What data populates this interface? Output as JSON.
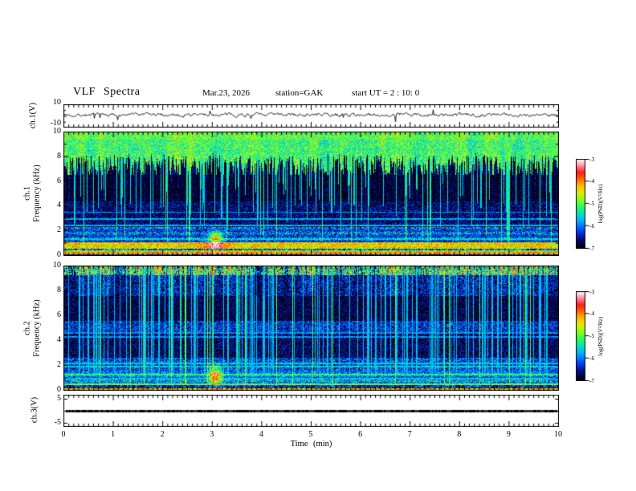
{
  "header": {
    "title": "VLF  Spectra",
    "date": "Mar.23, 2026",
    "station": "station=GAK",
    "start_ut": "start UT =  2 : 10: 0"
  },
  "xaxis": {
    "label": "Time  (min)",
    "ticks": [
      "0",
      "1",
      "2",
      "3",
      "4",
      "5",
      "6",
      "7",
      "8",
      "9",
      "10"
    ],
    "range": [
      0,
      10
    ]
  },
  "panels": {
    "ch1_wave": {
      "label": "ch.1(V)",
      "ytick_top": "10",
      "ytick_bottom": "-10",
      "ylim": [
        -10,
        10
      ]
    },
    "ch1_spec": {
      "label_ch": "ch.1",
      "label_axis": "Frequency  (kHz)",
      "yticks": [
        "0",
        "2",
        "4",
        "6",
        "8",
        "10"
      ],
      "ylim": [
        0,
        10
      ]
    },
    "ch2_spec": {
      "label_ch": "ch.2",
      "label_axis": "Frequency  (kHz)",
      "yticks": [
        "0",
        "2",
        "4",
        "6",
        "8",
        "10"
      ],
      "ylim": [
        0,
        10
      ]
    },
    "ch3_wave": {
      "label": "ch.3(V)",
      "ytick_top": "5",
      "ytick_bottom": "-5",
      "ylim": [
        -5,
        5
      ]
    }
  },
  "colorbar": {
    "label": "log(PSD)(V²/Hz)",
    "ticks": [
      "-3",
      "-4",
      "-5",
      "-6",
      "-7"
    ],
    "zlim": [
      -7,
      -3
    ],
    "scale_colors": [
      "#000008",
      "#0046ff",
      "#00aaff",
      "#28fa64",
      "#dcf000",
      "#ffbe00",
      "#ff1e14",
      "#ff8296",
      "#ffffff"
    ]
  },
  "chart_data": [
    {
      "type": "line",
      "name": "ch.1 voltage waveform",
      "xlabel": "Time (min)",
      "x_range": [
        0,
        10
      ],
      "ylabel": "ch.1(V)",
      "ylim": [
        -10,
        10
      ],
      "mean_v": 1.0,
      "noise_pp_v": 4.0,
      "spike_min_v": -8.0,
      "description": "continuous noisy VLF channel-1 voltage trace, mean about +1 V, with sporadic short negative spikes"
    },
    {
      "type": "heatmap",
      "name": "ch.1 spectrogram",
      "xlabel": "Time (min)",
      "x_range": [
        0,
        10
      ],
      "ylabel": "Frequency (kHz)",
      "ylim": [
        0,
        10
      ],
      "zlabel": "log(PSD)(V²/Hz)",
      "zlim": [
        -7,
        -3
      ],
      "bands": [
        {
          "f": [
            9.4,
            10.0
          ],
          "psd": -5.0,
          "jit": 0.14
        },
        {
          "f": [
            8.3,
            9.4
          ],
          "psd": -5.15,
          "jit": 0.15
        },
        {
          "f": [
            6.5,
            8.3
          ],
          "psd": -6.85,
          "jit": 0.12,
          "stalactite_psd": -5.1
        },
        {
          "f": [
            4.4,
            6.5
          ],
          "psd": -6.92,
          "jit": 0.1
        },
        {
          "f": [
            2.3,
            4.4
          ],
          "psd": -6.7,
          "jit": 0.14
        },
        {
          "f": [
            1.05,
            2.3
          ],
          "psd": -6.15,
          "jit": 0.17
        },
        {
          "f": [
            0.55,
            1.05
          ],
          "psd": -4.35,
          "jit": 0.14
        },
        {
          "f": [
            0.4,
            0.55
          ],
          "psd": -6.1,
          "jit": 0.35
        },
        {
          "f": [
            0.28,
            0.4
          ],
          "psd": -4.8,
          "jit": 0.25
        },
        {
          "f": [
            0.08,
            0.28
          ],
          "psd": -3.95,
          "jit": 0.18
        },
        {
          "f": [
            0.0,
            0.08
          ],
          "psd": -6.6,
          "jit": 0.2
        }
      ],
      "hlines": [
        {
          "f": 1.35,
          "psd": -5.9
        },
        {
          "f": 2.45,
          "psd": -5.75
        },
        {
          "f": 2.95,
          "psd": -5.8
        },
        {
          "f": 3.5,
          "psd": -5.9
        }
      ],
      "events": [
        {
          "t": 3.07,
          "f": 1.45,
          "st": 0.1,
          "sf": 0.38,
          "boost": 0.42
        },
        {
          "t": 3.05,
          "f": 0.72,
          "st": 0.16,
          "sf": 0.28,
          "boost": 0.25
        }
      ],
      "streaks": "dense impulsive sferic streaks descending from 10 kHz down to 2-6 kHz throughout the record"
    },
    {
      "type": "heatmap",
      "name": "ch.2 spectrogram",
      "xlabel": "Time (min)",
      "x_range": [
        0,
        10
      ],
      "ylabel": "Frequency (kHz)",
      "ylim": [
        0,
        10
      ],
      "zlabel": "log(PSD)(V²/Hz)",
      "zlim": [
        -7,
        -3
      ],
      "bands": [
        {
          "f": [
            9.25,
            10.0
          ],
          "psd": -5.8,
          "jit": 0.12,
          "striped": true
        },
        {
          "f": [
            7.6,
            9.25
          ],
          "psd": -6.5,
          "jit": 0.15
        },
        {
          "f": [
            5.6,
            7.6
          ],
          "psd": -6.8,
          "jit": 0.11
        },
        {
          "f": [
            4.6,
            5.6
          ],
          "psd": -6.35,
          "jit": 0.15
        },
        {
          "f": [
            2.6,
            4.6
          ],
          "psd": -6.75,
          "jit": 0.13
        },
        {
          "f": [
            1.6,
            2.6
          ],
          "psd": -6.25,
          "jit": 0.16
        },
        {
          "f": [
            0.55,
            1.6
          ],
          "psd": -5.95,
          "jit": 0.17
        },
        {
          "f": [
            0.42,
            0.55
          ],
          "psd": -4.9,
          "jit": 0.18
        },
        {
          "f": [
            0.15,
            0.42
          ],
          "psd": -6.4,
          "jit": 0.22
        },
        {
          "f": [
            0.06,
            0.15
          ],
          "psd": -4.15,
          "jit": 0.18
        },
        {
          "f": [
            0.0,
            0.06
          ],
          "psd": -6.9,
          "jit": 0.1
        }
      ],
      "hlines": [
        {
          "f": 0.95,
          "psd": -5.5
        },
        {
          "f": 1.25,
          "psd": -5.55
        },
        {
          "f": 1.9,
          "psd": -5.6
        },
        {
          "f": 2.15,
          "psd": -5.65
        },
        {
          "f": 4.3,
          "psd": -5.9
        },
        {
          "f": 4.6,
          "psd": -5.95
        }
      ],
      "events": [
        {
          "t": 3.07,
          "f": 1.15,
          "st": 0.09,
          "sf": 0.5,
          "boost": 0.5
        }
      ],
      "streaks": "many thin vertical cyan-green sferic lines over a blue background; dense striping in the 9-10 kHz band"
    },
    {
      "type": "line",
      "name": "ch.3 voltage waveform",
      "xlabel": "Time (min)",
      "x_range": [
        0,
        10
      ],
      "ylabel": "ch.3(V)",
      "ylim": [
        -5,
        5
      ],
      "mean_v": 0.0,
      "description": "flat dark trace constant at 0 V"
    }
  ]
}
